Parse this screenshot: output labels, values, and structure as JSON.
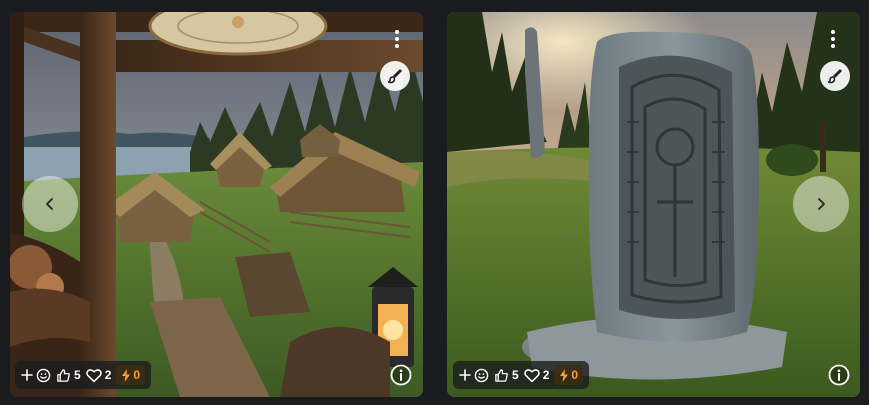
{
  "cards": [
    {
      "id": "left",
      "reactions": {
        "likes": "5",
        "hearts": "2",
        "tips": "0"
      }
    },
    {
      "id": "right",
      "reactions": {
        "likes": "5",
        "hearts": "2",
        "tips": "0"
      }
    }
  ],
  "colors": {
    "background": "#1a1b1e",
    "tip_accent": "#f5a623",
    "text": "#ffffff"
  },
  "icons": {
    "menu": "more-vertical-icon",
    "remix": "brush-icon",
    "prev": "chevron-left-icon",
    "next": "chevron-right-icon",
    "add_reaction": "plus-icon",
    "emoji": "smiley-icon",
    "like": "thumbs-up-icon",
    "heart": "heart-icon",
    "tip": "lightning-icon",
    "info": "info-icon"
  }
}
